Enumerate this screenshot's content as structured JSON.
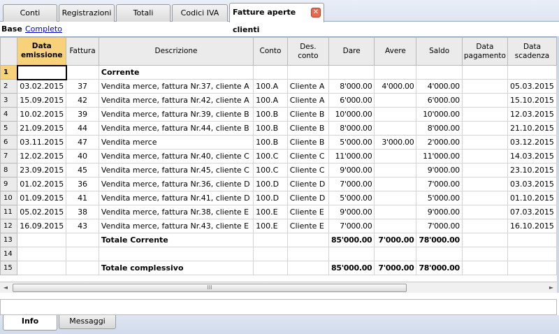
{
  "tabs": [
    "Conti",
    "Registrazioni",
    "Totali",
    "Codici IVA",
    "Fatture aperte clienti"
  ],
  "close_glyph": "✕",
  "views": {
    "base": "Base",
    "completo": "Completo"
  },
  "columns": [
    "Data emissione",
    "Fattura",
    "Descrizione",
    "Conto",
    "Des. conto",
    "Dare",
    "Avere",
    "Saldo",
    "Data pagamento",
    "Data scadenza"
  ],
  "rows": [
    {
      "n": "1",
      "data": "",
      "fattura": "",
      "descrizione": "Corrente",
      "conto": "",
      "des": "",
      "dare": "",
      "avere": "",
      "saldo": "",
      "pag": "",
      "scad": "",
      "bold": true
    },
    {
      "n": "2",
      "data": "03.02.2015",
      "fattura": "37",
      "descrizione": "Vendita merce, fattura Nr.37, cliente A",
      "conto": "100.A",
      "des": "Cliente A",
      "dare": "8'000.00",
      "avere": "4'000.00",
      "saldo": "4'000.00",
      "pag": "",
      "scad": "05.03.2015"
    },
    {
      "n": "3",
      "data": "15.09.2015",
      "fattura": "42",
      "descrizione": "Vendita merce, fattura Nr.42, cliente A",
      "conto": "100.A",
      "des": "Cliente A",
      "dare": "6'000.00",
      "avere": "",
      "saldo": "6'000.00",
      "pag": "",
      "scad": "15.10.2015"
    },
    {
      "n": "4",
      "data": "10.02.2015",
      "fattura": "39",
      "descrizione": "Vendita merce, fattura Nr.39, cliente B",
      "conto": "100.B",
      "des": "Cliente B",
      "dare": "10'000.00",
      "avere": "",
      "saldo": "10'000.00",
      "pag": "",
      "scad": "12.03.2015"
    },
    {
      "n": "5",
      "data": "21.09.2015",
      "fattura": "44",
      "descrizione": "Vendita merce, fattura Nr.44, cliente B",
      "conto": "100.B",
      "des": "Cliente B",
      "dare": "8'000.00",
      "avere": "",
      "saldo": "8'000.00",
      "pag": "",
      "scad": "21.10.2015"
    },
    {
      "n": "6",
      "data": "03.11.2015",
      "fattura": "47",
      "descrizione": "Vendita merce",
      "conto": "100.B",
      "des": "Cliente B",
      "dare": "5'000.00",
      "avere": "3'000.00",
      "saldo": "2'000.00",
      "pag": "",
      "scad": "03.12.2015"
    },
    {
      "n": "7",
      "data": "12.02.2015",
      "fattura": "40",
      "descrizione": "Vendita merce, fattura Nr.40, cliente C",
      "conto": "100.C",
      "des": "Cliente C",
      "dare": "11'000.00",
      "avere": "",
      "saldo": "11'000.00",
      "pag": "",
      "scad": "14.03.2015"
    },
    {
      "n": "8",
      "data": "23.09.2015",
      "fattura": "45",
      "descrizione": "Vendita merce, fattura Nr.45, cliente C",
      "conto": "100.C",
      "des": "Cliente C",
      "dare": "9'000.00",
      "avere": "",
      "saldo": "9'000.00",
      "pag": "",
      "scad": "23.10.2015"
    },
    {
      "n": "9",
      "data": "01.02.2015",
      "fattura": "36",
      "descrizione": "Vendita merce, fattura Nr.36, cliente D",
      "conto": "100.D",
      "des": "Cliente D",
      "dare": "7'000.00",
      "avere": "",
      "saldo": "7'000.00",
      "pag": "",
      "scad": "03.03.2015"
    },
    {
      "n": "10",
      "data": "01.09.2015",
      "fattura": "41",
      "descrizione": "Vendita merce, fattura Nr.41, cliente D",
      "conto": "100.D",
      "des": "Cliente D",
      "dare": "5'000.00",
      "avere": "",
      "saldo": "5'000.00",
      "pag": "",
      "scad": "01.10.2015"
    },
    {
      "n": "11",
      "data": "05.02.2015",
      "fattura": "38",
      "descrizione": "Vendita merce, fattura Nr.38, cliente E",
      "conto": "100.E",
      "des": "Cliente E",
      "dare": "9'000.00",
      "avere": "",
      "saldo": "9'000.00",
      "pag": "",
      "scad": "07.03.2015"
    },
    {
      "n": "12",
      "data": "16.09.2015",
      "fattura": "43",
      "descrizione": "Vendita merce, fattura Nr.43, cliente E",
      "conto": "100.E",
      "des": "Cliente E",
      "dare": "7'000.00",
      "avere": "",
      "saldo": "7'000.00",
      "pag": "",
      "scad": "16.10.2015"
    },
    {
      "n": "13",
      "data": "",
      "fattura": "",
      "descrizione": "Totale Corrente",
      "conto": "",
      "des": "",
      "dare": "85'000.00",
      "avere": "7'000.00",
      "saldo": "78'000.00",
      "pag": "",
      "scad": "",
      "bold": true
    },
    {
      "n": "14",
      "data": "",
      "fattura": "",
      "descrizione": "",
      "conto": "",
      "des": "",
      "dare": "",
      "avere": "",
      "saldo": "",
      "pag": "",
      "scad": ""
    },
    {
      "n": "15",
      "data": "",
      "fattura": "",
      "descrizione": "Totale complessivo",
      "conto": "",
      "des": "",
      "dare": "85'000.00",
      "avere": "7'000.00",
      "saldo": "78'000.00",
      "pag": "",
      "scad": "",
      "bold": true
    }
  ],
  "scrollbar": {
    "left_arrow": "◄",
    "right_arrow": "►",
    "grip": "III"
  },
  "bottom_tabs": [
    "Info",
    "Messaggi"
  ],
  "colors": {
    "selected_header": "#f8d27a",
    "tab_close": "#e86a4a"
  }
}
